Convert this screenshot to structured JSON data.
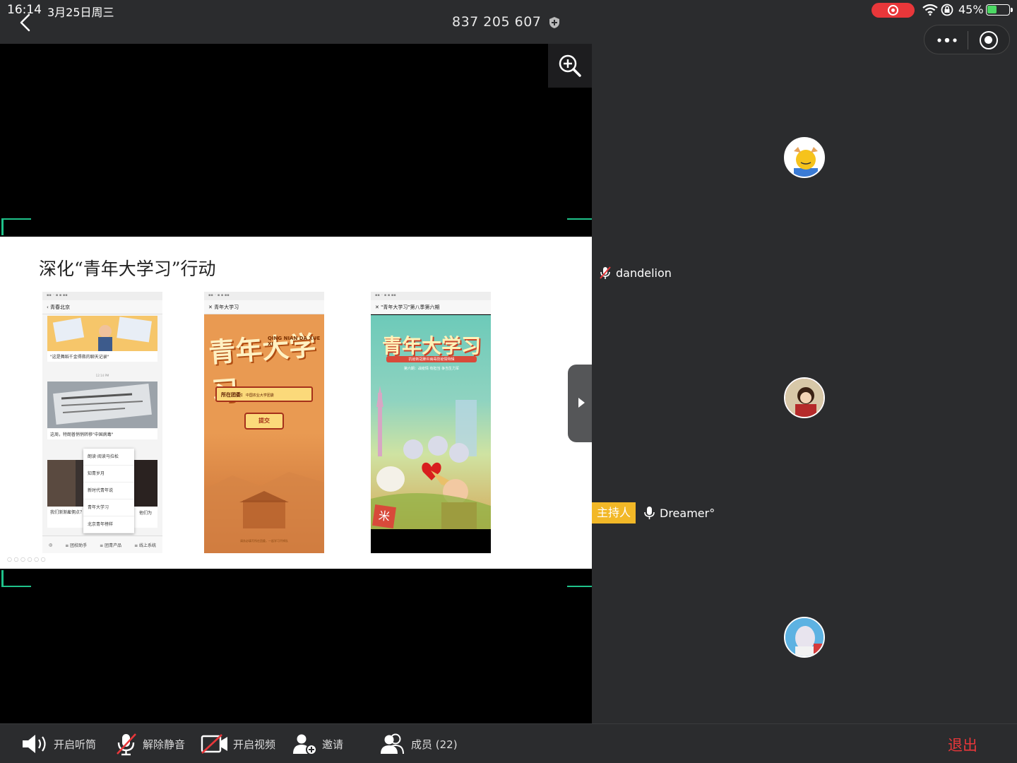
{
  "status": {
    "time": "16:14",
    "date": "3月25日周三",
    "battery": "45%",
    "battery_level": 0.45
  },
  "header": {
    "meeting_id": "837 205 607"
  },
  "slide": {
    "title": "深化“青年大学习”行动",
    "phone1": {
      "nav_title": "青春北京",
      "caption1": "\"这是舞蹈千金得救的聊天记录\"",
      "timestamp": "12:14 PM",
      "caption2": "这周，特朗普悄悄转移\"中国病毒\"",
      "caption3": "我们渐渐雇佣点？何者回国？",
      "caption3_right": "他们为",
      "menu": [
        "朗读·阅读马拉松",
        "知青岁月",
        "新时代青年说",
        "青年大学习",
        "北京青年榜样"
      ],
      "tabs": [
        "◎",
        "≡ 团校助手",
        "≡ 团青产品",
        "≡ 线上系统"
      ]
    },
    "phone2": {
      "nav_title": "青年大学习",
      "art_title": "青年大学习",
      "pinyin": "QING NIAN DA XUE XI",
      "field_label": "所在团委:",
      "field_value": "中国农业大学团委",
      "submit": "提交",
      "footer": "请务必填写所在团委，一起学习不掉队"
    },
    "phone3": {
      "nav_title": "\"青年大学习\"第八季第六期",
      "art_title": "青年大学习",
      "sub1": "抗疫新冠肺炎病毒防疫情特辑",
      "sub2": "第六期：战疫情 有担当 争当生力军",
      "badge": "米"
    }
  },
  "participants": [
    {
      "name": "dandelion",
      "muted": true
    },
    {
      "name": "Dreamer°",
      "muted": false,
      "host_label": "主持人"
    }
  ],
  "toolbar": {
    "speaker": "开启听筒",
    "unmute": "解除静音",
    "video": "开启视频",
    "invite": "邀请",
    "members": "成员 (22)",
    "exit": "退出"
  },
  "colors": {
    "accent_green": "#1fc28a",
    "record_red": "#e8373a",
    "host_yellow": "#f2b827"
  }
}
